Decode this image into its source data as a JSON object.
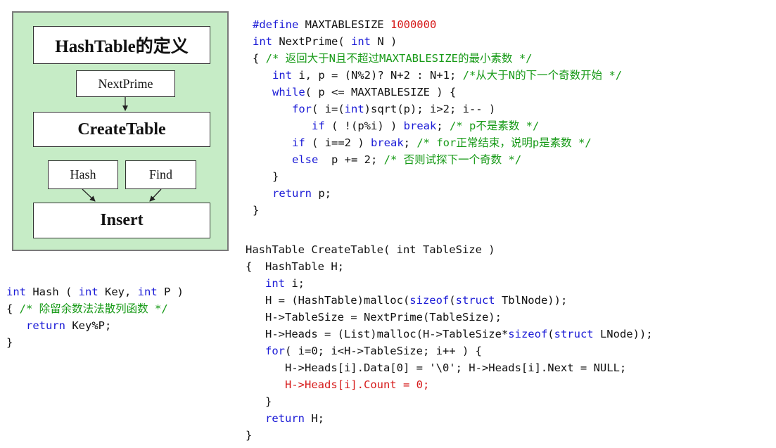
{
  "diagram": {
    "title": "HashTable的定义",
    "nextprime": "NextPrime",
    "createtable": "CreateTable",
    "hash": "Hash",
    "find": "Find",
    "insert": "Insert"
  },
  "code_blocks": [
    {
      "name": "nextprime-code",
      "lines": [
        [
          {
            "t": "#define",
            "c": "kw"
          },
          {
            "t": " MAXTABLESIZE "
          },
          {
            "t": "1000000",
            "c": "num"
          }
        ],
        [
          {
            "t": "int",
            "c": "kw"
          },
          {
            "t": " NextPrime( "
          },
          {
            "t": "int",
            "c": "kw"
          },
          {
            "t": " N )"
          }
        ],
        [
          {
            "t": "{ "
          },
          {
            "t": "/* 返回大于N且不超过MAXTABLESIZE的最小素数 */",
            "c": "cm"
          }
        ],
        [
          {
            "t": "   "
          },
          {
            "t": "int",
            "c": "kw"
          },
          {
            "t": " i, p = (N%2)? N+2 : N+1; "
          },
          {
            "t": "/*从大于N的下一个奇数开始 */",
            "c": "cm"
          }
        ],
        [
          {
            "t": "   "
          },
          {
            "t": "while",
            "c": "kw"
          },
          {
            "t": "( p <= MAXTABLESIZE ) {"
          }
        ],
        [
          {
            "t": "      "
          },
          {
            "t": "for",
            "c": "kw"
          },
          {
            "t": "( i=("
          },
          {
            "t": "int",
            "c": "kw"
          },
          {
            "t": ")sqrt(p); i>2; i-- )"
          }
        ],
        [
          {
            "t": "         "
          },
          {
            "t": "if",
            "c": "kw"
          },
          {
            "t": " ( !(p%i) ) "
          },
          {
            "t": "break",
            "c": "kw"
          },
          {
            "t": "; "
          },
          {
            "t": "/* p不是素数 */",
            "c": "cm"
          }
        ],
        [
          {
            "t": "      "
          },
          {
            "t": "if",
            "c": "kw"
          },
          {
            "t": " ( i==2 ) "
          },
          {
            "t": "break",
            "c": "kw"
          },
          {
            "t": "; "
          },
          {
            "t": "/* for正常结束，说明p是素数 */",
            "c": "cm"
          }
        ],
        [
          {
            "t": "      "
          },
          {
            "t": "else",
            "c": "kw"
          },
          {
            "t": "  p += 2; "
          },
          {
            "t": "/* 否则试探下一个奇数 */",
            "c": "cm"
          }
        ],
        [
          {
            "t": "   }"
          }
        ],
        [
          {
            "t": "   "
          },
          {
            "t": "return",
            "c": "kw"
          },
          {
            "t": " p;"
          }
        ],
        [
          {
            "t": "}"
          }
        ]
      ]
    },
    {
      "name": "hash-code",
      "lines": [
        [
          {
            "t": "int",
            "c": "kw"
          },
          {
            "t": " Hash ( "
          },
          {
            "t": "int",
            "c": "kw"
          },
          {
            "t": " Key, "
          },
          {
            "t": "int",
            "c": "kw"
          },
          {
            "t": " P )"
          }
        ],
        [
          {
            "t": "{ "
          },
          {
            "t": "/* 除留余数法法散列函数 */",
            "c": "cm"
          }
        ],
        [
          {
            "t": "   "
          },
          {
            "t": "return",
            "c": "kw"
          },
          {
            "t": " Key%P;"
          }
        ],
        [
          {
            "t": "}"
          }
        ]
      ]
    },
    {
      "name": "createtable-code",
      "lines": [
        [
          {
            "t": "HashTable CreateTable( int TableSize )"
          }
        ],
        [
          {
            "t": "{  HashTable H;"
          }
        ],
        [
          {
            "t": "   "
          },
          {
            "t": "int",
            "c": "kw"
          },
          {
            "t": " i;"
          }
        ],
        [
          {
            "t": "   H = (HashTable)malloc("
          },
          {
            "t": "sizeof",
            "c": "kw"
          },
          {
            "t": "("
          },
          {
            "t": "struct",
            "c": "kw"
          },
          {
            "t": " TblNode));"
          }
        ],
        [
          {
            "t": "   H->TableSize = NextPrime(TableSize);"
          }
        ],
        [
          {
            "t": "   H->Heads = (List)malloc(H->TableSize*"
          },
          {
            "t": "sizeof",
            "c": "kw"
          },
          {
            "t": "("
          },
          {
            "t": "struct",
            "c": "kw"
          },
          {
            "t": " LNode));"
          }
        ],
        [
          {
            "t": "   "
          },
          {
            "t": "for",
            "c": "kw"
          },
          {
            "t": "( i=0; i<H->TableSize; i++ ) {"
          }
        ],
        [
          {
            "t": "      H->Heads[i].Data[0] = '\\0'; H->Heads[i].Next = NULL;"
          }
        ],
        [
          {
            "t": "      "
          },
          {
            "t": "H->Heads[i].Count = 0;",
            "c": "hl"
          }
        ],
        [
          {
            "t": "   }"
          }
        ],
        [
          {
            "t": "   "
          },
          {
            "t": "return",
            "c": "kw"
          },
          {
            "t": " H;"
          }
        ],
        [
          {
            "t": "}"
          }
        ]
      ]
    }
  ]
}
